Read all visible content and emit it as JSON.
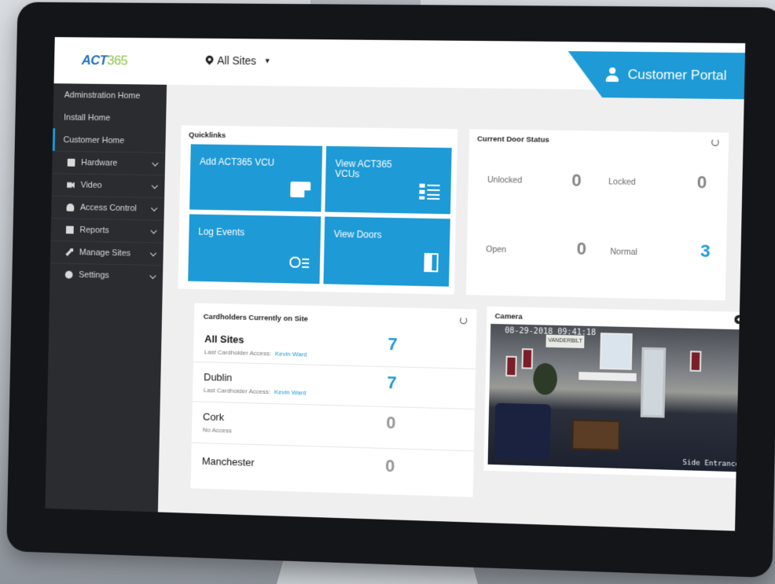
{
  "header": {
    "logo_act": "ACT",
    "logo_num": "365",
    "site_selector": "All Sites",
    "portal_label": "Customer Portal"
  },
  "sidebar": {
    "items": [
      {
        "label": "Adminstration Home",
        "icon": "",
        "chevron": false
      },
      {
        "label": "Install Home",
        "icon": "",
        "chevron": false
      },
      {
        "label": "Customer Home",
        "icon": "",
        "chevron": false,
        "active": true
      },
      {
        "label": "Hardware",
        "icon": "hardware-icon",
        "chevron": true
      },
      {
        "label": "Video",
        "icon": "video-camera-icon",
        "chevron": true
      },
      {
        "label": "Access Control",
        "icon": "user-icon",
        "chevron": true
      },
      {
        "label": "Reports",
        "icon": "reports-icon",
        "chevron": true
      },
      {
        "label": "Manage Sites",
        "icon": "wrench-icon",
        "chevron": true
      },
      {
        "label": "Settings",
        "icon": "gear-icon",
        "chevron": true
      }
    ]
  },
  "quicklinks": {
    "title": "Quicklinks",
    "tiles": [
      {
        "label": "Add ACT365 VCU",
        "icon": "add-device-icon"
      },
      {
        "label": "View ACT365 VCUs",
        "icon": "list-icon"
      },
      {
        "label": "Log Events",
        "icon": "clock-list-icon"
      },
      {
        "label": "View Doors",
        "icon": "door-icon"
      }
    ]
  },
  "door_status": {
    "title": "Current Door Status",
    "items": [
      {
        "label": "Unlocked",
        "value": "0"
      },
      {
        "label": "Locked",
        "value": "0"
      },
      {
        "label": "Open",
        "value": "0"
      },
      {
        "label": "Normal",
        "value": "3"
      }
    ]
  },
  "cardholders": {
    "title": "Cardholders Currently on Site",
    "rows": [
      {
        "name": "All Sites",
        "sub_label": "Last Cardholder Access:",
        "sub_link": "Kevin Ward",
        "count": "7"
      },
      {
        "name": "Dublin",
        "sub_label": "Last Cardholder Access:",
        "sub_link": "Kevin Ward",
        "count": "7"
      },
      {
        "name": "Cork",
        "sub_label": "No Access",
        "sub_link": "",
        "count": "0"
      },
      {
        "name": "Manchester",
        "sub_label": "",
        "sub_link": "",
        "count": "0"
      }
    ]
  },
  "camera": {
    "title": "Camera",
    "timestamp": "08-29-2018 09:41:18",
    "banner": "VANDERBILT",
    "caption": "Side Entrance"
  },
  "colors": {
    "accent": "#1e9ad6",
    "sidebar_bg": "#2a2c30",
    "logo_blue": "#1f6fb5",
    "logo_green": "#8bc34a"
  }
}
